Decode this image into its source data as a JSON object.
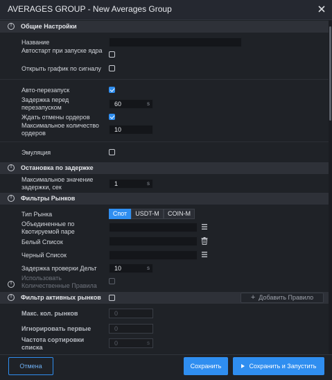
{
  "window": {
    "title": "AVERAGES GROUP - New Averages Group",
    "close_icon": "close-icon"
  },
  "sections": {
    "general": "Общие Настройки",
    "delay_stop": "Остановка по задержке",
    "market_filters": "Фильтры Рынков",
    "active_markets": "Фильтр активных рынков"
  },
  "general": {
    "name_label": "Название",
    "name_value": "",
    "autostart_label": "Автостарт при запуске ядра",
    "autostart_checked": false,
    "open_chart_label": "Открыть график по сигналу",
    "open_chart_checked": false,
    "auto_restart_label": "Авто-перезапуск",
    "auto_restart_checked": true,
    "restart_delay_label": "Задержка перед перезапуском",
    "restart_delay_value": "60",
    "restart_delay_unit": "s",
    "wait_cancel_label": "Ждать отмены ордеров",
    "wait_cancel_checked": true,
    "max_orders_label": "Максимальное количество ордеров",
    "max_orders_value": "10",
    "emulation_label": "Эмуляция",
    "emulation_checked": false
  },
  "delay_stop": {
    "max_delay_label": "Максимальное значение задержки, сек",
    "max_delay_value": "1",
    "max_delay_unit": "s"
  },
  "market_filters": {
    "market_type_label": "Тип Рынка",
    "market_types": [
      "Спот",
      "USDT-M",
      "COIN-M"
    ],
    "selected_market_type": "Спот",
    "combined_label": "Объединенные по Квотируемой паре",
    "combined_value": "",
    "whitelist_label": "Белый Список",
    "whitelist_value": "",
    "blacklist_label": "Черный Список",
    "blacklist_value": "",
    "delta_delay_label": "Задержка проверки Дельт",
    "delta_delay_value": "10",
    "delta_delay_unit": "s",
    "quantity_rules_label": "Использовать Количественные Правила",
    "quantity_rules_checked": false
  },
  "active_markets": {
    "enabled": false,
    "add_rule_label": "Добавить Правило",
    "max_markets_label": "Макс. кол. рынков",
    "max_markets_value": "0",
    "ignore_first_label": "Игнорировать первые",
    "ignore_first_value": "0",
    "sort_freq_label": "Частота сортировки списка",
    "sort_freq_value": "0",
    "sort_freq_unit": "s"
  },
  "footer": {
    "cancel_label": "Отмена",
    "save_label": "Сохранить",
    "save_run_label": "Сохранить и Запустить"
  },
  "colors": {
    "accent": "#2f8ef0",
    "background": "#1f2227",
    "section_header": "#2e3138"
  }
}
